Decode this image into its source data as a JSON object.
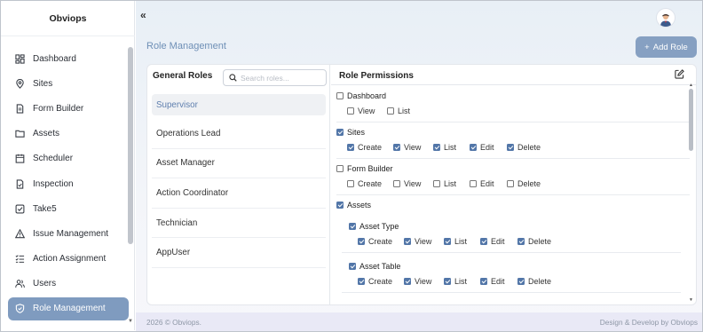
{
  "brand": "Obviops",
  "sidebar": {
    "items": [
      {
        "label": "Dashboard",
        "icon": "dashboard-icon"
      },
      {
        "label": "Sites",
        "icon": "map-pin-icon"
      },
      {
        "label": "Form Builder",
        "icon": "document-icon"
      },
      {
        "label": "Assets",
        "icon": "folder-icon"
      },
      {
        "label": "Scheduler",
        "icon": "calendar-icon"
      },
      {
        "label": "Inspection",
        "icon": "inspection-icon"
      },
      {
        "label": "Take5",
        "icon": "checkbox-icon"
      },
      {
        "label": "Issue Management",
        "icon": "warning-icon"
      },
      {
        "label": "Action Assignment",
        "icon": "list-check-icon"
      },
      {
        "label": "Users",
        "icon": "users-icon"
      },
      {
        "label": "Role Management",
        "icon": "shield-icon",
        "active": true
      }
    ]
  },
  "header": {
    "page_title": "Role Management",
    "add_role_label": "Add Role"
  },
  "roles": {
    "heading": "General Roles",
    "search_placeholder": "Search roles...",
    "items": [
      "Supervisor",
      "Operations Lead",
      "Asset Manager",
      "Action Coordinator",
      "Technician",
      "AppUser"
    ],
    "selected": "Supervisor"
  },
  "permissions": {
    "heading": "Role Permissions",
    "modules": [
      {
        "name": "Dashboard",
        "checked": false,
        "perms": [
          {
            "label": "View",
            "checked": false
          },
          {
            "label": "List",
            "checked": false
          }
        ]
      },
      {
        "name": "Sites",
        "checked": true,
        "perms": [
          {
            "label": "Create",
            "checked": true
          },
          {
            "label": "View",
            "checked": true
          },
          {
            "label": "List",
            "checked": true
          },
          {
            "label": "Edit",
            "checked": true
          },
          {
            "label": "Delete",
            "checked": true
          }
        ]
      },
      {
        "name": "Form Builder",
        "checked": false,
        "perms": [
          {
            "label": "Create",
            "checked": false
          },
          {
            "label": "View",
            "checked": false
          },
          {
            "label": "List",
            "checked": false
          },
          {
            "label": "Edit",
            "checked": false
          },
          {
            "label": "Delete",
            "checked": false
          }
        ]
      },
      {
        "name": "Assets",
        "checked": true,
        "perms": [],
        "submodules": [
          {
            "name": "Asset Type",
            "checked": true,
            "perms": [
              {
                "label": "Create",
                "checked": true
              },
              {
                "label": "View",
                "checked": true
              },
              {
                "label": "List",
                "checked": true
              },
              {
                "label": "Edit",
                "checked": true
              },
              {
                "label": "Delete",
                "checked": true
              }
            ]
          },
          {
            "name": "Asset Table",
            "checked": true,
            "perms": [
              {
                "label": "Create",
                "checked": true
              },
              {
                "label": "View",
                "checked": true
              },
              {
                "label": "List",
                "checked": true
              },
              {
                "label": "Edit",
                "checked": true
              },
              {
                "label": "Delete",
                "checked": true
              }
            ]
          }
        ]
      }
    ]
  },
  "footer": {
    "left": "2026 © Obviops.",
    "right": "Design & Develop by Obviops"
  },
  "colors": {
    "accent": "#7f9bbf",
    "title": "#6e8fb6",
    "checkbox": "#5276a8"
  }
}
